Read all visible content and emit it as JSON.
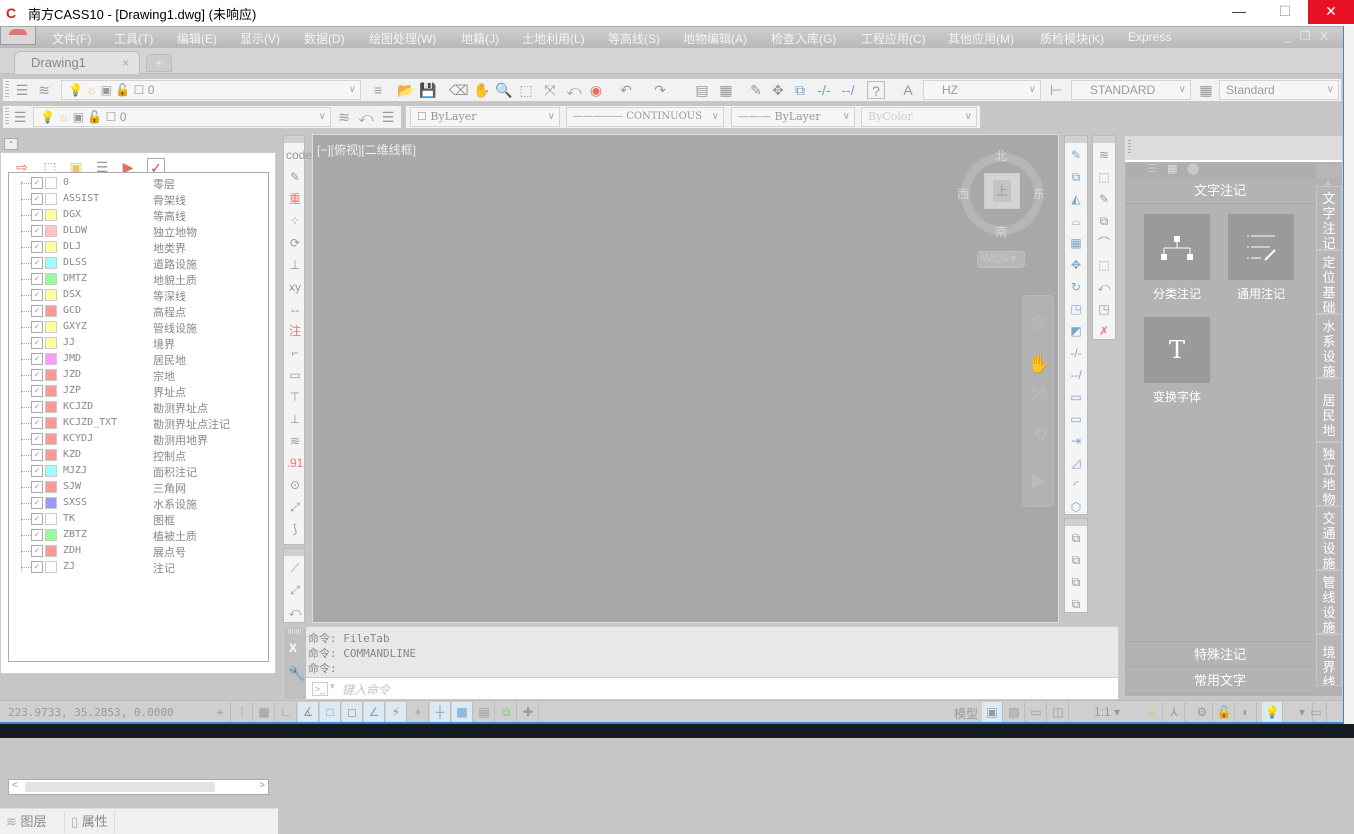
{
  "window": {
    "title": "南方CASS10 - [Drawing1.dwg] (未响应)",
    "app_icon": "cass-logo-icon",
    "minimize": "—",
    "maximize": "☐",
    "close": "✕"
  },
  "menubar": {
    "items": [
      "文件(F)",
      "工具(T)",
      "编辑(E)",
      "显示(V)",
      "数据(D)",
      "绘图处理(W)",
      "地籍(J)",
      "土地利用(L)",
      "等高线(S)",
      "地物编辑(A)",
      "检查入库(G)",
      "工程应用(C)",
      "其他应用(M)",
      "质检模块(K)",
      "Express"
    ],
    "mdi_controls": "_ ❐ X"
  },
  "file_tabs": {
    "tabs": [
      {
        "label": "Drawing1",
        "close": "×"
      }
    ],
    "new_tab": "+"
  },
  "toolbar_row1": {
    "layer_combo_value": "0",
    "text_style_value": "HZ",
    "dim_style_value": "STANDARD",
    "table_style_value": "Standard",
    "help_label": "?"
  },
  "toolbar_row2": {
    "layer_combo_value": "0",
    "color_value": "ByLayer",
    "linetype_value": "CONTINUOUS",
    "lineweight_value": "ByLayer",
    "plotstyle_value": "ByColor"
  },
  "layer_panel": {
    "search_value": "",
    "layers": [
      {
        "name": "0",
        "desc": "零层",
        "color": "#ffffff"
      },
      {
        "name": "ASSIST",
        "desc": "骨架线",
        "color": "#ffffff"
      },
      {
        "name": "DGX",
        "desc": "等高线",
        "color": "#ffff99"
      },
      {
        "name": "DLDW",
        "desc": "独立地物",
        "color": "#ffc4c4"
      },
      {
        "name": "DLJ",
        "desc": "地类界",
        "color": "#ffff99"
      },
      {
        "name": "DLSS",
        "desc": "道路设施",
        "color": "#99ffff"
      },
      {
        "name": "DMTZ",
        "desc": "地貌土质",
        "color": "#99ff99"
      },
      {
        "name": "DSX",
        "desc": "等深线",
        "color": "#ffff99"
      },
      {
        "name": "GCD",
        "desc": "高程点",
        "color": "#ff9999"
      },
      {
        "name": "GXYZ",
        "desc": "管线设施",
        "color": "#ffff99"
      },
      {
        "name": "JJ",
        "desc": "境界",
        "color": "#ffff99"
      },
      {
        "name": "JMD",
        "desc": "居民地",
        "color": "#ff99ff"
      },
      {
        "name": "JZD",
        "desc": "宗地",
        "color": "#ff9999"
      },
      {
        "name": "JZP",
        "desc": "界址点",
        "color": "#ff9999"
      },
      {
        "name": "KCJZD",
        "desc": "勘测界址点",
        "color": "#ff9999"
      },
      {
        "name": "KCJZD_TXT",
        "desc": "勘测界址点注记",
        "color": "#ff9999"
      },
      {
        "name": "KCYDJ",
        "desc": "勘测用地界",
        "color": "#ff9999"
      },
      {
        "name": "KZD",
        "desc": "控制点",
        "color": "#ff9999"
      },
      {
        "name": "MJZJ",
        "desc": "面积注记",
        "color": "#99ffff"
      },
      {
        "name": "SJW",
        "desc": "三角网",
        "color": "#ff9999"
      },
      {
        "name": "SXSS",
        "desc": "水系设施",
        "color": "#9999ff"
      },
      {
        "name": "TK",
        "desc": "图框",
        "color": "#ffffff"
      },
      {
        "name": "ZBTZ",
        "desc": "植被土质",
        "color": "#99ff99"
      },
      {
        "name": "ZDH",
        "desc": "展点号",
        "color": "#ff9999"
      },
      {
        "name": "ZJ",
        "desc": "注记",
        "color": "#ffffff"
      }
    ],
    "checkmark": "✓",
    "tabs": [
      {
        "label": "图层",
        "icon": "layers-icon"
      },
      {
        "label": "属性",
        "icon": "properties-icon"
      }
    ],
    "scroll_left": "<",
    "scroll_right": ">"
  },
  "left_vtoolbar": {
    "items": [
      "code",
      "✎",
      "重",
      "⁘",
      "⟳",
      "⊥",
      "xy",
      "↔",
      "注",
      "⌐",
      "▭",
      "⊤",
      "⊥",
      "≋",
      ".91",
      "⊙",
      "⤢",
      "⟆"
    ],
    "items2": [
      "⟋",
      "⤢",
      "⤺"
    ]
  },
  "drawing": {
    "view_label": "[−][俯视][二维线框]",
    "compass": {
      "north": "北",
      "south": "南",
      "east": "东",
      "west": "西",
      "top_face": "上"
    },
    "wcs_label": "WCS ▾"
  },
  "command_line": {
    "history": [
      "命令: FileTab",
      "命令: COMMANDLINE",
      "命令:"
    ],
    "close": "X",
    "input_placeholder": "键入命令",
    "prompt_icon": ">_"
  },
  "tool_palette": {
    "active_section": "文字注记",
    "tools": [
      {
        "label": "分类注记",
        "icon": "hierarchy-icon"
      },
      {
        "label": "通用注记",
        "icon": "text-edit-icon"
      },
      {
        "label": "变换字体",
        "icon": "font-T-icon",
        "glyph": "T"
      }
    ],
    "bottom_sections": [
      "特殊注记",
      "常用文字"
    ],
    "vertical_tabs": [
      "文字注记",
      "定位基础",
      "水系设施",
      "居民地",
      "独立地物",
      "交通设施",
      "管线设施",
      "境界线"
    ]
  },
  "statusbar": {
    "coordinates": "223.9733, 35.2853, 0.0000",
    "model_label": "模型",
    "annotation_scale": "1:1 ▾"
  }
}
